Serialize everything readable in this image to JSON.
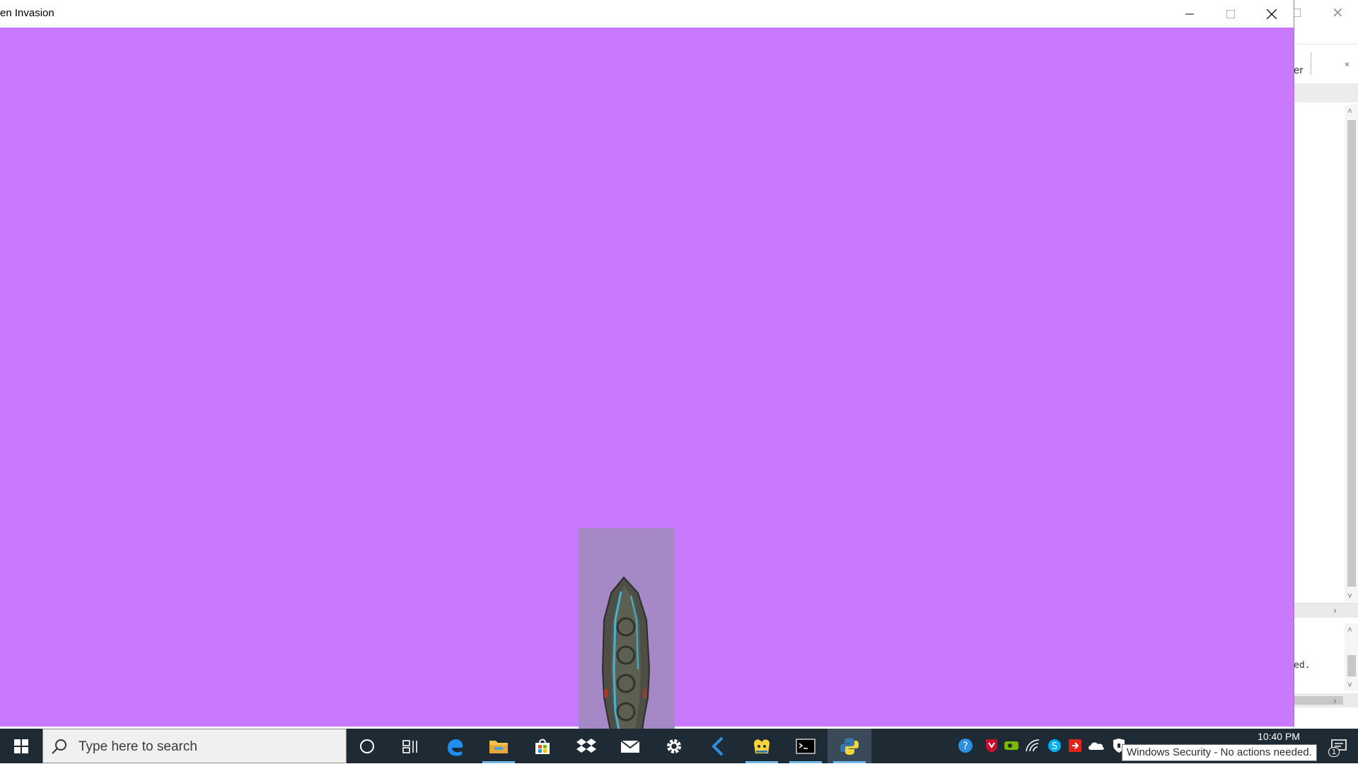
{
  "game_window": {
    "title": "en Invasion",
    "buttons": {
      "minimize": "minimize",
      "maximize": "maximize",
      "close": "close"
    }
  },
  "background_window": {
    "tab_fragment": "er",
    "tab_close": "×",
    "output_fragment": "ed."
  },
  "taskbar": {
    "search_placeholder": "Type here to search",
    "pinned": [
      "cortana",
      "task-view",
      "edge",
      "file-explorer",
      "store",
      "dropbox",
      "mail",
      "settings",
      "visual-studio-code",
      "python-idle",
      "terminal",
      "python-game"
    ],
    "active_app": "python-game",
    "tray": [
      "help-icon",
      "mcafee-icon",
      "nvidia-icon",
      "network-icon",
      "skype-icon",
      "red-app-icon",
      "onedrive-icon",
      "windows-security-icon"
    ],
    "clock": "10:40 PM",
    "notification_count": "1",
    "tooltip": "Windows Security - No actions needed."
  },
  "colors": {
    "game_background": "#c879fd",
    "ship_rect": "#a588c6",
    "taskbar": "#1f2b34",
    "accent": "#76b9ed"
  }
}
